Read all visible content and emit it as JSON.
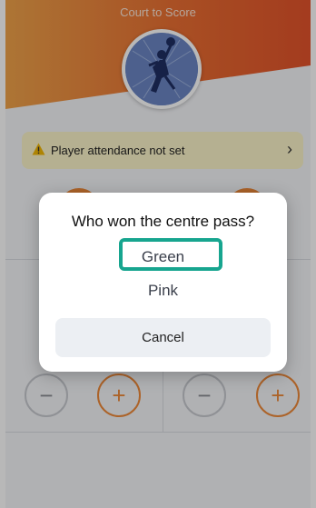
{
  "header": {
    "title": "Court to Score"
  },
  "attendance_alert": {
    "text": "Player attendance not set",
    "chevron": "›"
  },
  "score_controls": {
    "minus_symbol": "−",
    "plus_symbol": "+"
  },
  "dialog": {
    "title": "Who won the centre pass?",
    "options": [
      "Green",
      "Pink"
    ],
    "cancel_label": "Cancel"
  },
  "colors": {
    "accent": "#ef8a3a",
    "highlight": "#17a58f",
    "alert_bg": "#fbf4c9"
  }
}
